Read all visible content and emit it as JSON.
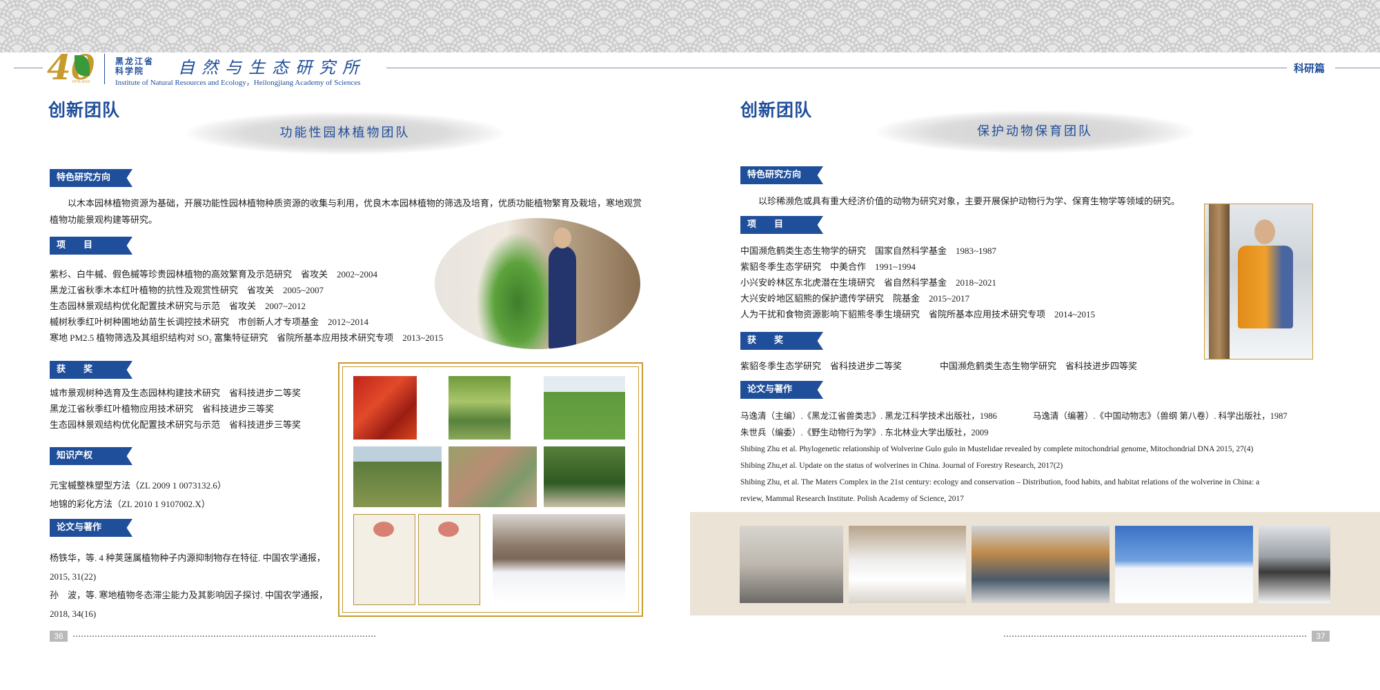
{
  "header": {
    "org_name_line1": "黑龙江省",
    "org_name_line2": "科学院",
    "calligraphy": "自然与生态研究所",
    "english_name": "Institute of Natural Resources and Ecology，Heilongjiang Academy of Sciences",
    "logo_number": "40",
    "logo_years": "1978-2018",
    "section_tag": "科研篇"
  },
  "left": {
    "title": "创新团队",
    "team": "功能性园林植物团队",
    "direction_tag": "特色研究方向",
    "direction_text": "以木本园林植物资源为基础，开展功能性园林植物种质资源的收集与利用，优良木本园林植物的筛选及培育，优质功能植物繁育及栽培，寒地观赏植物功能景观构建等研究。",
    "projects_tag": "项　　目",
    "projects": [
      "紫杉、白牛槭、假色槭等珍贵园林植物的高效繁育及示范研究　省攻关　2002~2004",
      "黑龙江省秋季木本红叶植物的抗性及观赏性研究　省攻关　2005~2007",
      "生态园林景观结构优化配置技术研究与示范　省攻关　2007~2012",
      "槭树秋季红叶树种圃地幼苗生长调控技术研究　市创新人才专项基金　2012~2014",
      "寒地 PM2.5 植物筛选及其组织结构对 SO₂ 富集特征研究　省院所基本应用技术研究专项　2013~2015"
    ],
    "awards_tag": "获　　奖",
    "awards": [
      "城市景观树种选育及生态园林构建技术研究　省科技进步二等奖",
      "黑龙江省秋季红叶植物应用技术研究　省科技进步三等奖",
      "生态园林景观结构优化配置技术研究与示范　省科技进步三等奖"
    ],
    "ip_tag": "知识产权",
    "ip": [
      "元宝槭整株塑型方法（ZL 2009 1 0073132.6）",
      "地锦的彩化方法（ZL 2010 1 9107002.X）"
    ],
    "papers_tag": "论文与著作",
    "papers": [
      "杨铁华，等. 4 种荚蒾属植物种子内源抑制物存在特征. 中国农学通报，",
      "2015, 31(22)",
      "孙　波，等. 寒地植物冬态滞尘能力及其影响因子探讨. 中国农学通报，",
      "2018, 34(16)"
    ],
    "page_number": "36"
  },
  "right": {
    "title": "创新团队",
    "team": "保护动物保育团队",
    "direction_tag": "特色研究方向",
    "direction_text": "以珍稀濒危或具有重大经济价值的动物为研究对象，主要开展保护动物行为学、保育生物学等领域的研究。",
    "projects_tag": "项　　目",
    "projects": [
      "中国濒危鹤类生态生物学的研究　国家自然科学基金　1983~1987",
      "紫貂冬季生态学研究　中美合作　1991~1994",
      "小兴安岭林区东北虎潜在生境研究　省自然科学基金　2018~2021",
      "大兴安岭地区貂熊的保护遗传学研究　院基金　2015~2017",
      "人为干扰和食物资源影响下貂熊冬季生境研究　省院所基本应用技术研究专项　2014~2015"
    ],
    "awards_tag": "获　　奖",
    "awards": [
      "紫貂冬季生态学研究　省科技进步二等奖",
      "中国濒危鹤类生态生物学研究　省科技进步四等奖"
    ],
    "papers_tag": "论文与著作",
    "papers": [
      "马逸清（主编）.《黑龙江省兽类志》. 黑龙江科学技术出版社，1986",
      "马逸清（编著）.《中国动物志》（兽纲 第八卷）. 科学出版社，1987",
      "朱世兵（编委）.《野生动物行为学》. 东北林业大学出版社，2009",
      "Shibing Zhu et al. Phylogenetic relationship of Wolverine Gulo gulo in Mustelidae revealed by complete mitochondrial genome, Mitochondrial DNA  2015, 27(4)",
      "Shibing Zhu,et al. Update on the status of wolverines in China. Journal of Forestry Research, 2017(2)",
      "Shibing Zhu, et al. The Maters Complex in the 21st century: ecology and conservation – Distribution, food habits, and habitat relations of the wolverine in China: a",
      "review, Mammal Research Institute. Polish Academy of Science, 2017"
    ],
    "page_number": "37"
  },
  "colors": {
    "accent": "#1f4e9a",
    "gold": "#c79a2e",
    "beige_band": "#ebe3d6"
  }
}
